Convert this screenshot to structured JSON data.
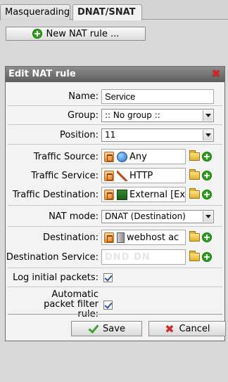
{
  "tabs": [
    {
      "label": "Masquerading"
    },
    {
      "label": "DNAT/SNAT"
    }
  ],
  "toolbar": {
    "new_rule_label": "New NAT rule ..."
  },
  "dialog": {
    "title": "Edit NAT rule",
    "close_icon": "close-icon",
    "fields": {
      "name": {
        "label": "Name:",
        "value": "Service"
      },
      "group": {
        "label": "Group:",
        "value": ":: No group ::"
      },
      "position": {
        "label": "Position:",
        "value": "11"
      },
      "traffic_source": {
        "label": "Traffic Source:",
        "value": "Any"
      },
      "traffic_service": {
        "label": "Traffic Service:",
        "value": "HTTP"
      },
      "traffic_destination": {
        "label": "Traffic Destination:",
        "value": "External [Ex"
      },
      "nat_mode": {
        "label": "NAT mode:",
        "value": "DNAT (Destination)"
      },
      "destination": {
        "label": "Destination:",
        "value": "webhost ac"
      },
      "destination_service": {
        "label": "Destination Service:",
        "placeholder": "DND DN"
      },
      "log_initial": {
        "label": "Log initial packets:",
        "checked": true
      },
      "auto_filter": {
        "label": "Automatic packet filter rule:",
        "checked": true
      }
    },
    "buttons": {
      "save": "Save",
      "cancel": "Cancel"
    }
  },
  "colors": {
    "accent_green": "#27a318",
    "close_red": "#d22222",
    "title_bar": "#6d6d6d"
  }
}
